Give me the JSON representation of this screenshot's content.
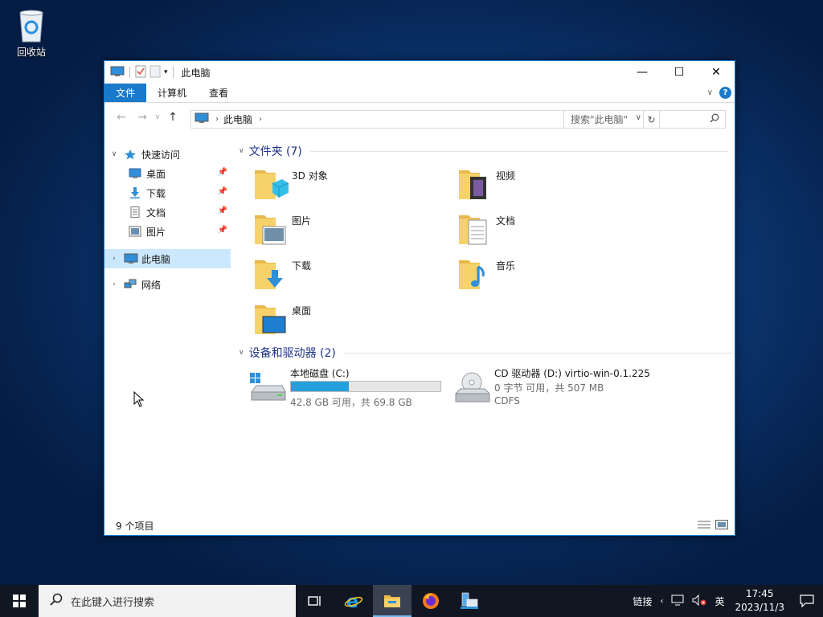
{
  "desktop": {
    "icons": [
      {
        "label": "回收站",
        "icon": "recycle-bin-icon"
      }
    ]
  },
  "window": {
    "title": "此电脑",
    "controls": {
      "minimize": "—",
      "maximize": "☐",
      "close": "✕"
    },
    "ribbon": {
      "tabs": [
        {
          "label": "文件",
          "active": true
        },
        {
          "label": "计算机",
          "active": false
        },
        {
          "label": "查看",
          "active": false
        }
      ]
    },
    "address": {
      "crumb": "此电脑"
    },
    "search": {
      "placeholder": "搜索\"此电脑\""
    },
    "sidebar": {
      "quick_access": "快速访问",
      "pinned": [
        {
          "label": "桌面",
          "icon": "desktop-icon"
        },
        {
          "label": "下载",
          "icon": "download-icon"
        },
        {
          "label": "文档",
          "icon": "document-icon"
        },
        {
          "label": "图片",
          "icon": "picture-icon"
        }
      ],
      "this_pc": "此电脑",
      "network": "网络"
    },
    "groups": {
      "folders_title": "文件夹 (7)",
      "drives_title": "设备和驱动器 (2)"
    },
    "folders": [
      {
        "name": "3D 对象",
        "icon": "3d-objects-icon"
      },
      {
        "name": "视频",
        "icon": "video-icon"
      },
      {
        "name": "图片",
        "icon": "picture-icon"
      },
      {
        "name": "文档",
        "icon": "document-icon"
      },
      {
        "name": "下载",
        "icon": "download-icon"
      },
      {
        "name": "音乐",
        "icon": "music-icon"
      },
      {
        "name": "桌面",
        "icon": "desktop-icon"
      }
    ],
    "drives": [
      {
        "name": "本地磁盘 (C:)",
        "info": "42.8 GB 可用，共 69.8 GB",
        "used_fraction": 0.387,
        "icon": "hard-drive-icon"
      },
      {
        "name": "CD 驱动器 (D:) virtio-win-0.1.225",
        "info": "0 字节 可用，共 507 MB",
        "fs": "CDFS",
        "icon": "cd-drive-icon"
      }
    ],
    "status": {
      "count": "9 个项目"
    }
  },
  "taskbar": {
    "search_placeholder": "在此键入进行搜索",
    "apps": [
      "task-view-icon",
      "internet-explorer-icon",
      "file-explorer-icon",
      "firefox-icon",
      "server-manager-icon"
    ],
    "tray": {
      "links": "链接",
      "ime": "英",
      "time": "17:45",
      "date": "2023/11/3"
    }
  },
  "colors": {
    "accent": "#1979ca",
    "selection": "#cce8ff",
    "progress": "#26a0da",
    "folder": "#f7d26a",
    "taskbar": "#101622"
  }
}
